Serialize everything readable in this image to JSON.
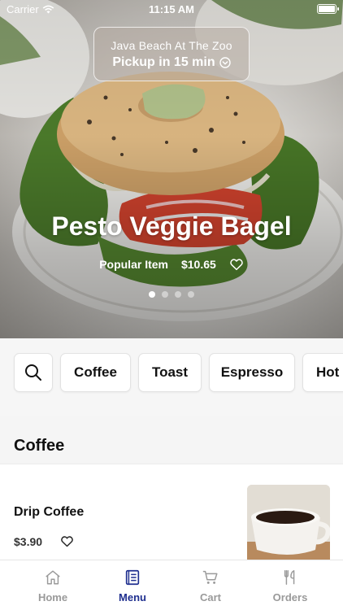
{
  "status_bar": {
    "carrier": "Carrier",
    "time": "11:15 AM"
  },
  "location": {
    "name": "Java Beach At The Zoo",
    "pickup": "Pickup in 15 min"
  },
  "hero": {
    "title": "Pesto Veggie Bagel",
    "tag": "Popular Item",
    "price": "$10.65",
    "carousel_active_index": 0,
    "carousel_count": 4
  },
  "categories": [
    "Coffee",
    "Toast",
    "Espresso",
    "Hot"
  ],
  "section": {
    "title": "Coffee"
  },
  "menu_item": {
    "name": "Drip Coffee",
    "price": "$3.90"
  },
  "tabs": [
    {
      "label": "Home",
      "icon": "home-icon"
    },
    {
      "label": "Menu",
      "icon": "menu-book-icon"
    },
    {
      "label": "Cart",
      "icon": "cart-icon"
    },
    {
      "label": "Orders",
      "icon": "fork-knife-icon"
    }
  ],
  "colors": {
    "accent": "#1f2f8f",
    "inactive_tab": "#9a9a9a"
  }
}
